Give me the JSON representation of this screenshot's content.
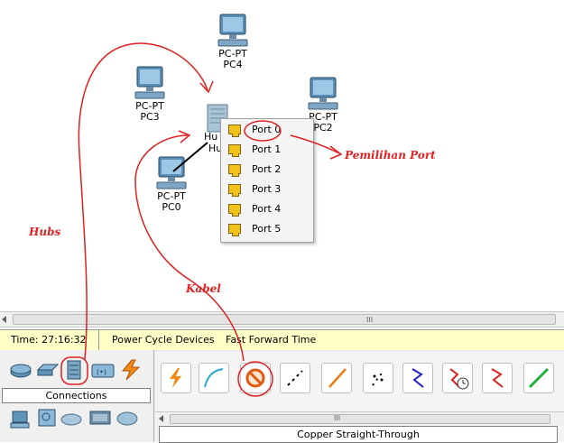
{
  "devices": [
    {
      "id": "pc4",
      "type": "PC-PT",
      "name": "PC4"
    },
    {
      "id": "pc3",
      "type": "PC-PT",
      "name": "PC3"
    },
    {
      "id": "pc2",
      "type": "PC-PT",
      "name": "PC2"
    },
    {
      "id": "pc0",
      "type": "PC-PT",
      "name": "PC0"
    }
  ],
  "hub": {
    "label1": "Hu",
    "label2": "Hu"
  },
  "port_menu": {
    "items": [
      "Port 0",
      "Port 1",
      "Port 2",
      "Port 3",
      "Port 4",
      "Port 5"
    ],
    "highlighted": "Port 0"
  },
  "annotations": {
    "port_selection": "Pemilihan Port",
    "hubs": "Hubs",
    "cable": "Kabel"
  },
  "statusbar": {
    "time": "Time: 27:16:32",
    "power_cycle": "Power Cycle Devices",
    "fast_forward": "Fast Forward Time"
  },
  "connections_label": "Connections",
  "selected_cable": "Copper Straight-Through",
  "scrollbar_grip": "III",
  "colors": {
    "annotation": "#e02020",
    "status_bg": "#ffffc8",
    "port_icon": "#f2c21b"
  }
}
